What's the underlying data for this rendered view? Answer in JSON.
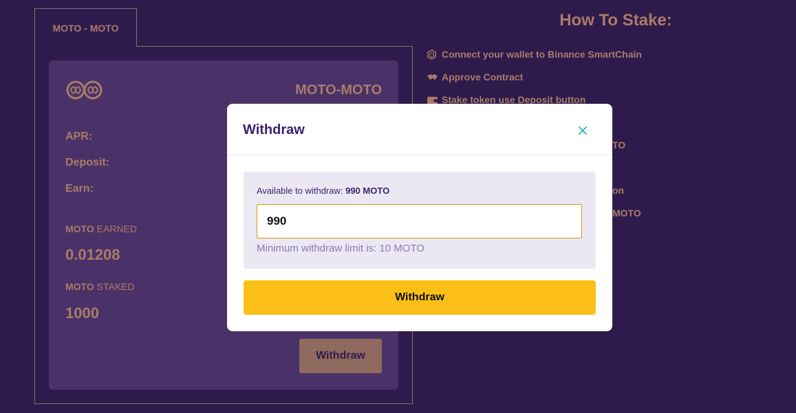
{
  "pool": {
    "tab_label": "MOTO - MOTO",
    "name": "MOTO-MOTO",
    "apr_label": "APR:",
    "deposit_label": "Deposit:",
    "earn_label": "Earn:",
    "earned": {
      "token": "MOTO",
      "suffix": "EARNED",
      "value": "0.01208"
    },
    "staked": {
      "token": "MOTO",
      "suffix": "STAKED",
      "value": "1000"
    },
    "withdraw_label": "Withdraw"
  },
  "howto": {
    "title": "How To Stake:",
    "steps": [
      {
        "icon": "blockchain-icon",
        "text": "Connect your wallet to Binance SmartChain"
      },
      {
        "icon": "handshake-icon",
        "text": "Approve Contract"
      },
      {
        "icon": "wallet-icon",
        "text": "Stake token use Deposit button"
      },
      {
        "icon": "",
        "text": ""
      },
      {
        "icon": "",
        "text": "TO"
      },
      {
        "icon": "",
        "text": ""
      },
      {
        "icon": "",
        "text": "on"
      },
      {
        "icon": "",
        "text": "MOTO"
      }
    ]
  },
  "modal": {
    "title": "Withdraw",
    "available_prefix": "Available to withdraw:",
    "available_amount": "990 MOTO",
    "input_value": "990",
    "limit_text": "Minimum withdraw limit is: 10 MOTO",
    "button_label": "Withdraw"
  },
  "colors": {
    "background": "#2e1b4c",
    "card": "#4a3268",
    "muted_text": "#a97b69",
    "modal_title": "#3b2371",
    "primary_button": "#fbbf18",
    "close_icon": "#1fb6c9"
  }
}
